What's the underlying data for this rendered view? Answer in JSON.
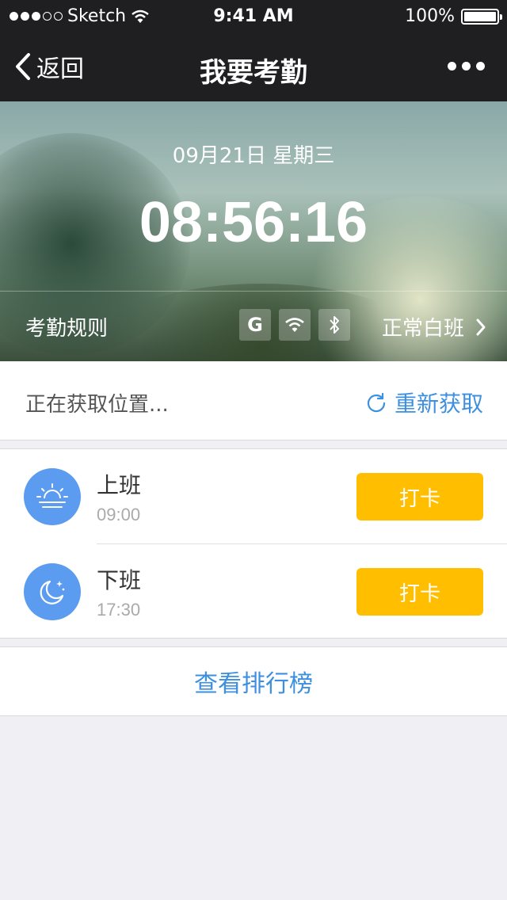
{
  "status_bar": {
    "carrier": "Sketch",
    "time": "9:41 AM",
    "battery": "100%"
  },
  "nav": {
    "back_label": "返回",
    "title": "我要考勤"
  },
  "hero": {
    "date": "09月21日  星期三",
    "clock": "08:56:16",
    "rules_label": "考勤规则",
    "signal_icons": [
      "G"
    ],
    "shift_label": "正常白班"
  },
  "location": {
    "status": "正在获取位置...",
    "refresh_label": "重新获取"
  },
  "records": [
    {
      "title": "上班",
      "time": "09:00",
      "button": "打卡",
      "icon": "sunrise-icon"
    },
    {
      "title": "下班",
      "time": "17:30",
      "button": "打卡",
      "icon": "moon-icon"
    }
  ],
  "ranking": {
    "label": "查看排行榜"
  },
  "colors": {
    "nav_bg": "#1f1f21",
    "accent_blue": "#3d8fe0",
    "button_yellow": "#ffbf00",
    "avatar_blue": "#5b9bf0"
  }
}
